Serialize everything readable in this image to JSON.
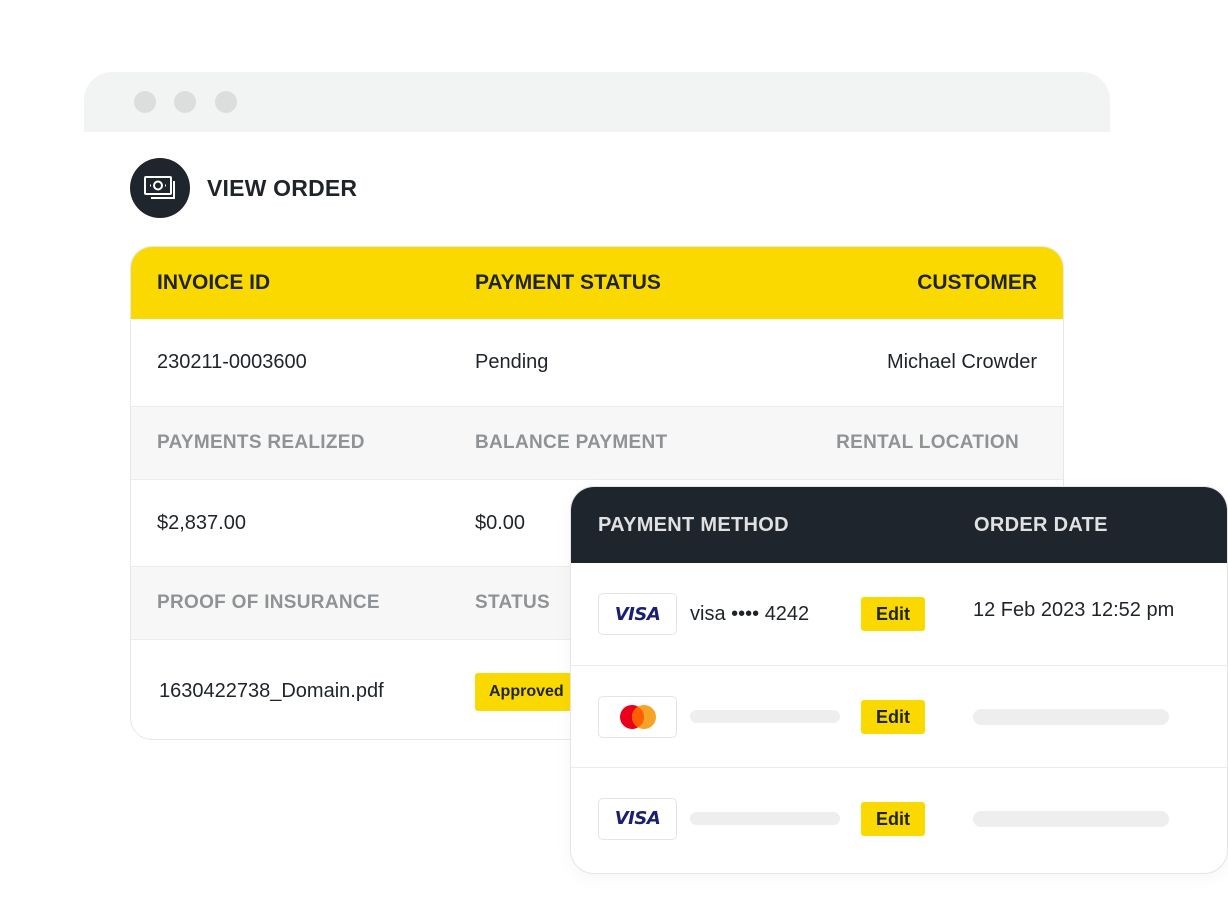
{
  "window": {
    "controls": [
      "close",
      "minimize",
      "maximize"
    ]
  },
  "header": {
    "icon": "money-icon",
    "title": "VIEW ORDER"
  },
  "order": {
    "columns": [
      "INVOICE ID",
      "PAYMENT STATUS",
      "CUSTOMER"
    ],
    "row1": {
      "invoice_id": "230211-0003600",
      "payment_status": "Pending",
      "customer": "Michael Crowder"
    },
    "labels2": [
      "PAYMENTS REALIZED",
      "BALANCE PAYMENT",
      "RENTAL LOCATION"
    ],
    "row2": {
      "payments_realized": "$2,837.00",
      "balance_payment": "$0.00"
    },
    "labels3": [
      "PROOF OF INSURANCE",
      "STATUS"
    ],
    "row3": {
      "proof_file": "1630422738_Domain.pdf",
      "status": "Approved"
    }
  },
  "payment": {
    "columns": [
      "PAYMENT METHOD",
      "ORDER DATE"
    ],
    "rows": [
      {
        "brand": "VISA",
        "brand_icon": "visa-icon",
        "masked": "visa •••• 4242",
        "edit": "Edit",
        "date": "12 Feb 2023 12:52 pm"
      },
      {
        "brand": "Mastercard",
        "brand_icon": "mastercard-icon",
        "edit": "Edit"
      },
      {
        "brand": "VISA",
        "brand_icon": "visa-icon",
        "edit": "Edit"
      }
    ]
  },
  "colors": {
    "accent": "#FAD900",
    "dark": "#1F252C"
  }
}
